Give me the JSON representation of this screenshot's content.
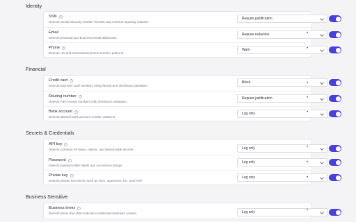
{
  "sections": [
    {
      "title": "Identity",
      "rows": [
        {
          "name": "SSN",
          "desc": "Detects Social Security number formats and common spacing variants.",
          "action": "Require justification",
          "enabled": true
        },
        {
          "name": "Email",
          "desc": "Detects personal and business email addresses.",
          "action": "Require redaction",
          "enabled": true
        },
        {
          "name": "Phone",
          "desc": "Detects US and international phone number patterns.",
          "action": "Warn",
          "enabled": true
        }
      ]
    },
    {
      "title": "Financial",
      "rows": [
        {
          "name": "Credit card",
          "desc": "Detects payment card numbers using format and checksum validation.",
          "action": "Block",
          "enabled": true
        },
        {
          "name": "Routing number",
          "desc": "Detects ABA routing numbers with checksum validation.",
          "action": "Require justification",
          "enabled": true
        },
        {
          "name": "Bank account",
          "desc": "Detects labeled bank account number patterns.",
          "action": "Log only",
          "enabled": true
        }
      ]
    },
    {
      "title": "Secrets & Credentials",
      "rows": [
        {
          "name": "API key",
          "desc": "Detects common API keys, tokens, and bearer-style secrets.",
          "action": "Log only",
          "enabled": true
        },
        {
          "name": "Password",
          "desc": "Detects password-like labels and connection strings.",
          "action": "Log only",
          "enabled": true
        },
        {
          "name": "Private key",
          "desc": "Detects private key blocks such as RSA, OpenSSH, EC, and PGP.",
          "action": "Log only",
          "enabled": true
        }
      ]
    },
    {
      "title": "Business Sensitive",
      "rows": [
        {
          "name": "Business terms",
          "desc": "Detects terms that often indicate confidential business context.",
          "action": "Log only",
          "enabled": true
        }
      ]
    }
  ],
  "icons": {
    "info": "info-icon",
    "more": "more-icon",
    "chevron": "chevron-down-icon"
  },
  "colors": {
    "toggle_on": "#4a3fd6",
    "page_bg": "#f4f4f6"
  },
  "more_glyph": "•"
}
